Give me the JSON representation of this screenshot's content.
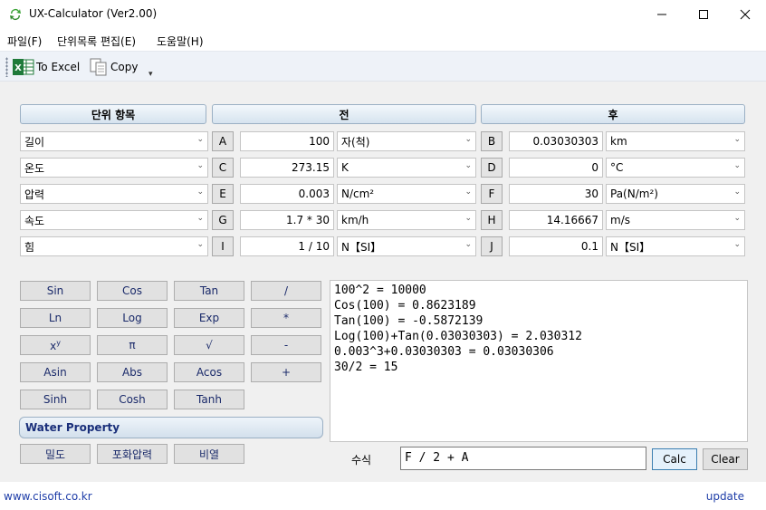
{
  "window": {
    "title": "UX-Calculator (Ver2.00)",
    "minimize": "—",
    "maximize": "☐",
    "close": "✕"
  },
  "menu": [
    "파일(F)",
    "단위목록 편집(E)",
    "도움말(H)"
  ],
  "toolbar": {
    "excel_label": "To Excel",
    "copy_label": "Copy",
    "overflow": "▾"
  },
  "headers": {
    "category": "단위 항목",
    "before": "전",
    "after": "후"
  },
  "rows": [
    {
      "category": "길이",
      "in_letter": "A",
      "in_value": "100",
      "in_unit": "자(척)",
      "out_letter": "B",
      "out_value": "0.03030303",
      "out_unit": "km"
    },
    {
      "category": "온도",
      "in_letter": "C",
      "in_value": "273.15",
      "in_unit": "K",
      "out_letter": "D",
      "out_value": "0",
      "out_unit": "°C"
    },
    {
      "category": "압력",
      "in_letter": "E",
      "in_value": "0.003",
      "in_unit": "N/cm²",
      "out_letter": "F",
      "out_value": "30",
      "out_unit": "Pa(N/m²)"
    },
    {
      "category": "속도",
      "in_letter": "G",
      "in_value": "1.7 * 30",
      "in_unit": "km/h",
      "out_letter": "H",
      "out_value": "14.16667",
      "out_unit": "m/s"
    },
    {
      "category": "힘",
      "in_letter": "I",
      "in_value": "1 / 10",
      "in_unit": "N【SI】",
      "out_letter": "J",
      "out_value": "0.1",
      "out_unit": "N【SI】"
    }
  ],
  "keypad": [
    [
      "Sin",
      "Cos",
      "Tan",
      "/"
    ],
    [
      "Ln",
      "Log",
      "Exp",
      "*"
    ],
    [
      "x^y",
      "π",
      "√",
      "-"
    ],
    [
      "Asin",
      "Abs",
      "Acos",
      "+"
    ],
    [
      "Sinh",
      "Cosh",
      "Tanh"
    ]
  ],
  "water_property": {
    "title": "Water Property",
    "buttons": [
      "밀도",
      "포화압력",
      "비열"
    ]
  },
  "history": [
    "100^2 = 10000",
    "Cos(100) = 0.8623189",
    "Tan(100) = -0.5872139",
    "Log(100)+Tan(0.03030303) = 2.030312",
    "0.003^3+0.03030303 = 0.03030306",
    "30/2 = 15"
  ],
  "formula": {
    "label": "수식",
    "value": "F / 2 + A",
    "calc": "Calc",
    "clear": "Clear"
  },
  "status": {
    "left": "www.cisoft.co.kr",
    "right": "update"
  },
  "colors": {
    "accent": "#1e3da8",
    "header_bg": "#d6e3ef",
    "panel_bg": "#f0f0f0"
  }
}
